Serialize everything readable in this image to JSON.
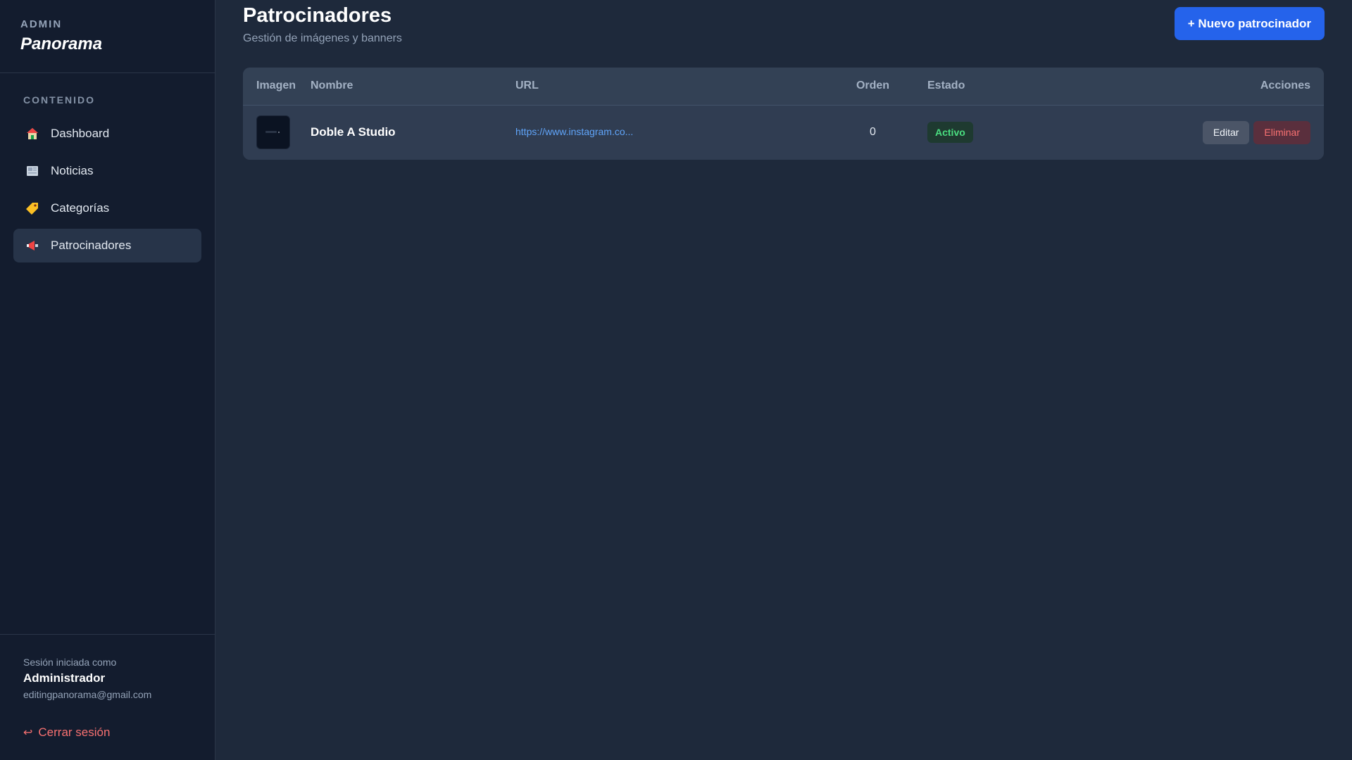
{
  "sidebar": {
    "brand_admin": "ADMIN",
    "brand_name": "Panorama",
    "section_heading": "CONTENIDO",
    "items": [
      {
        "label": "Dashboard",
        "icon": "house-icon",
        "active": false
      },
      {
        "label": "Noticias",
        "icon": "newspaper-icon",
        "active": false
      },
      {
        "label": "Categorías",
        "icon": "tag-icon",
        "active": false
      },
      {
        "label": "Patrocinadores",
        "icon": "megaphone-icon",
        "active": true
      }
    ],
    "footer": {
      "session_label": "Sesión iniciada como",
      "user_name": "Administrador",
      "user_email": "editingpanorama@gmail.com",
      "logout_label": "Cerrar sesión"
    }
  },
  "header": {
    "title": "Patrocinadores",
    "subtitle": "Gestión de imágenes y banners",
    "new_button_label": "+ Nuevo patrocinador"
  },
  "table": {
    "columns": {
      "image": "Imagen",
      "name": "Nombre",
      "url": "URL",
      "order": "Orden",
      "status": "Estado",
      "actions": "Acciones"
    },
    "rows": [
      {
        "name": "Doble A Studio",
        "url": "https://www.instagram.co...",
        "order": "0",
        "status": "Activo",
        "edit_label": "Editar",
        "delete_label": "Eliminar"
      }
    ]
  },
  "colors": {
    "accent": "#2563eb",
    "status_active": "#4ade80",
    "danger": "#f87171",
    "link": "#60a5fa"
  }
}
